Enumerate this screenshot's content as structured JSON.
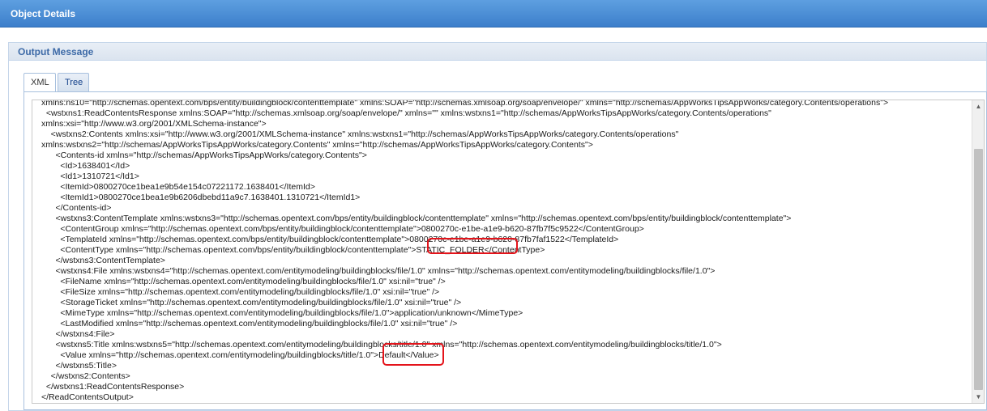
{
  "window": {
    "title": "Object Details"
  },
  "panel": {
    "title": "Output Message"
  },
  "tabs": [
    {
      "label": "XML",
      "active": true
    },
    {
      "label": "Tree",
      "active": false
    }
  ],
  "xml": {
    "lines": [
      "xmlns:ns10=\"http://schemas.opentext.com/bps/entity/buildingblock/contenttemplate\" xmlns:SOAP=\"http://schemas.xmlsoap.org/soap/envelope/\" xmlns=\"http://schemas/AppWorksTipsAppWorks/category.Contents/operations\">",
      "  <wstxns1:ReadContentsResponse xmlns:SOAP=\"http://schemas.xmlsoap.org/soap/envelope/\" xmlns=\"\" xmlns:wstxns1=\"http://schemas/AppWorksTipsAppWorks/category.Contents/operations\"",
      "xmlns:xsi=\"http://www.w3.org/2001/XMLSchema-instance\">",
      "    <wstxns2:Contents xmlns:xsi=\"http://www.w3.org/2001/XMLSchema-instance\" xmlns:wstxns1=\"http://schemas/AppWorksTipsAppWorks/category.Contents/operations\"",
      "xmlns:wstxns2=\"http://schemas/AppWorksTipsAppWorks/category.Contents\" xmlns=\"http://schemas/AppWorksTipsAppWorks/category.Contents\">",
      "      <Contents-id xmlns=\"http://schemas/AppWorksTipsAppWorks/category.Contents\">",
      "        <Id>1638401</Id>",
      "        <Id1>1310721</Id1>",
      "        <ItemId>0800270ce1bea1e9b54e154c07221172.1638401</ItemId>",
      "        <ItemId1>0800270ce1bea1e9b6206dbebd11a9c7.1638401.1310721</ItemId1>",
      "      </Contents-id>",
      "      <wstxns3:ContentTemplate xmlns:wstxns3=\"http://schemas.opentext.com/bps/entity/buildingblock/contenttemplate\" xmlns=\"http://schemas.opentext.com/bps/entity/buildingblock/contenttemplate\">",
      "        <ContentGroup xmlns=\"http://schemas.opentext.com/bps/entity/buildingblock/contenttemplate\">0800270c-e1be-a1e9-b620-87fb7f5c9522</ContentGroup>",
      "        <TemplateId xmlns=\"http://schemas.opentext.com/bps/entity/buildingblock/contenttemplate\">0800270c-e1be-a1e9-b620-87fb7faf1522</TemplateId>",
      "        <ContentType xmlns=\"http://schemas.opentext.com/bps/entity/buildingblock/contenttemplate\">STATIC_FOLDER</ContentType>",
      "      </wstxns3:ContentTemplate>",
      "      <wstxns4:File xmlns:wstxns4=\"http://schemas.opentext.com/entitymodeling/buildingblocks/file/1.0\" xmlns=\"http://schemas.opentext.com/entitymodeling/buildingblocks/file/1.0\">",
      "        <FileName xmlns=\"http://schemas.opentext.com/entitymodeling/buildingblocks/file/1.0\" xsi:nil=\"true\" />",
      "        <FileSize xmlns=\"http://schemas.opentext.com/entitymodeling/buildingblocks/file/1.0\" xsi:nil=\"true\" />",
      "        <StorageTicket xmlns=\"http://schemas.opentext.com/entitymodeling/buildingblocks/file/1.0\" xsi:nil=\"true\" />",
      "        <MimeType xmlns=\"http://schemas.opentext.com/entitymodeling/buildingblocks/file/1.0\">application/unknown</MimeType>",
      "        <LastModified xmlns=\"http://schemas.opentext.com/entitymodeling/buildingblocks/file/1.0\" xsi:nil=\"true\" />",
      "      </wstxns4:File>",
      "      <wstxns5:Title xmlns:wstxns5=\"http://schemas.opentext.com/entitymodeling/buildingblocks/title/1.0\" xmlns=\"http://schemas.opentext.com/entitymodeling/buildingblocks/title/1.0\">",
      "        <Value xmlns=\"http://schemas.opentext.com/entitymodeling/buildingblocks/title/1.0\">Default</Value>",
      "      </wstxns5:Title>",
      "    </wstxns2:Contents>",
      "  </wstxns1:ReadContentsResponse>",
      "</ReadContentsOutput>"
    ]
  },
  "colors": {
    "titlebar": "#3d7fcb",
    "panel_title": "#3d6aa7",
    "highlight": "#e4141b"
  }
}
